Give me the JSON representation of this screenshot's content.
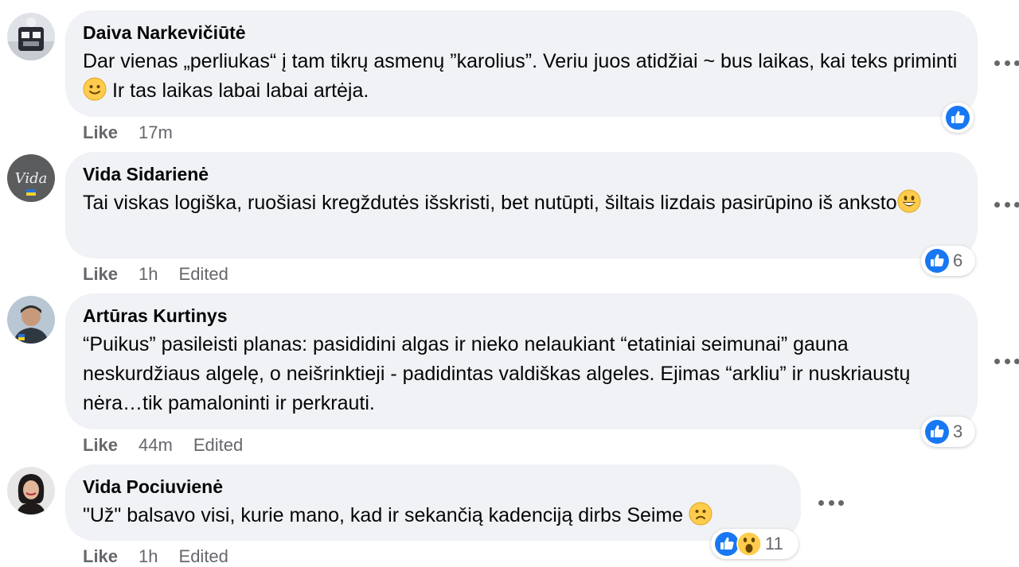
{
  "colors": {
    "bubble_bg": "#f0f2f5",
    "meta_text": "#65676b",
    "like_blue": "#1877f2",
    "emoji_yellow": "#ffcc4d"
  },
  "comments": [
    {
      "author": "Daiva Narkevičiūtė",
      "text_before": "Dar vienas „perliukas“ į tam tikrų asmenų ”karolius”. Veriu juos atidžiai ~ bus laikas, kai teks priminti",
      "emoji": "slightly-smiling-face-emoji",
      "text_after": " Ir tas laikas labai labai artėja.",
      "like_label": "Like",
      "time": "17m",
      "edited": "",
      "reactions": [
        "like-reaction-icon"
      ],
      "reaction_count": ""
    },
    {
      "author": "Vida Sidarienė",
      "text_before": "Tai viskas logiška, ruošiasi kregždutės išskristi, bet nutūpti, šiltais lizdais pasirūpino iš anksto",
      "emoji": "grinning-face-emoji",
      "text_after": "",
      "like_label": "Like",
      "time": "1h",
      "edited": "Edited",
      "reactions": [
        "like-reaction-icon"
      ],
      "reaction_count": "6"
    },
    {
      "author": "Artūras Kurtinys",
      "text_before": "“Puikus” pasileisti planas: pasididini algas ir nieko nelaukiant “etatiniai seimunai” gauna neskurdžiaus algelę, o neišrinktieji - padidintas valdiškas algeles. Ejimas “arkliu” ir nuskriaustų nėra…tik pamaloninti ir perkrauti.",
      "emoji": "",
      "text_after": "",
      "like_label": "Like",
      "time": "44m",
      "edited": "Edited",
      "reactions": [
        "like-reaction-icon"
      ],
      "reaction_count": "3"
    },
    {
      "author": "Vida Pociuvienė",
      "text_before": "\"Už\" balsavo visi, kurie mano, kad ir sekančią kadenciją dirbs Seime",
      "emoji": "frowning-face-emoji",
      "text_after": "",
      "like_label": "Like",
      "time": "1h",
      "edited": "Edited",
      "reactions": [
        "like-reaction-icon",
        "wow-reaction-icon"
      ],
      "reaction_count": "11"
    }
  ]
}
